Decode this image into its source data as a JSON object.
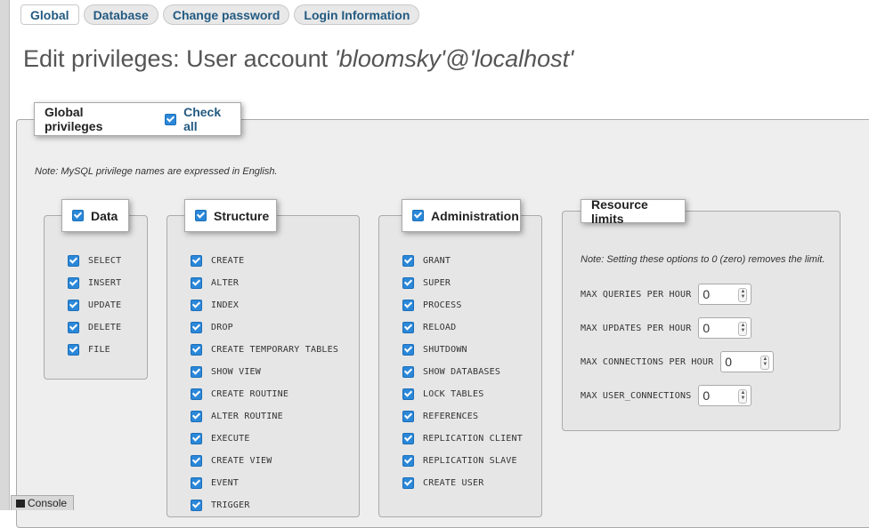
{
  "tabs": [
    {
      "label": "Global",
      "active": true
    },
    {
      "label": "Database",
      "active": false
    },
    {
      "label": "Change password",
      "active": false
    },
    {
      "label": "Login Information",
      "active": false
    }
  ],
  "page_title": {
    "prefix": "Edit privileges: User account ",
    "account": "'bloomsky'@'localhost'"
  },
  "global": {
    "legend": "Global privileges",
    "check_all_label": "Check all",
    "check_all_checked": true,
    "note": "Note: MySQL privilege names are expressed in English."
  },
  "data_group": {
    "legend": "Data",
    "privileges": [
      "SELECT",
      "INSERT",
      "UPDATE",
      "DELETE",
      "FILE"
    ]
  },
  "structure_group": {
    "legend": "Structure",
    "privileges": [
      "CREATE",
      "ALTER",
      "INDEX",
      "DROP",
      "CREATE TEMPORARY TABLES",
      "SHOW VIEW",
      "CREATE ROUTINE",
      "ALTER ROUTINE",
      "EXECUTE",
      "CREATE VIEW",
      "EVENT",
      "TRIGGER"
    ]
  },
  "admin_group": {
    "legend": "Administration",
    "privileges": [
      "GRANT",
      "SUPER",
      "PROCESS",
      "RELOAD",
      "SHUTDOWN",
      "SHOW DATABASES",
      "LOCK TABLES",
      "REFERENCES",
      "REPLICATION CLIENT",
      "REPLICATION SLAVE",
      "CREATE USER"
    ]
  },
  "resource_limits": {
    "legend": "Resource limits",
    "note": "Note: Setting these options to 0 (zero) removes the limit.",
    "fields": [
      {
        "label": "MAX QUERIES PER HOUR",
        "value": "0"
      },
      {
        "label": "MAX UPDATES PER HOUR",
        "value": "0"
      },
      {
        "label": "MAX CONNECTIONS PER HOUR",
        "value": "0"
      },
      {
        "label": "MAX USER_CONNECTIONS",
        "value": "0"
      }
    ]
  },
  "console": {
    "label": "Console"
  },
  "colors": {
    "accent": "#235a81",
    "checkbox": "#2b88d9",
    "panel": "#eeeeee"
  }
}
